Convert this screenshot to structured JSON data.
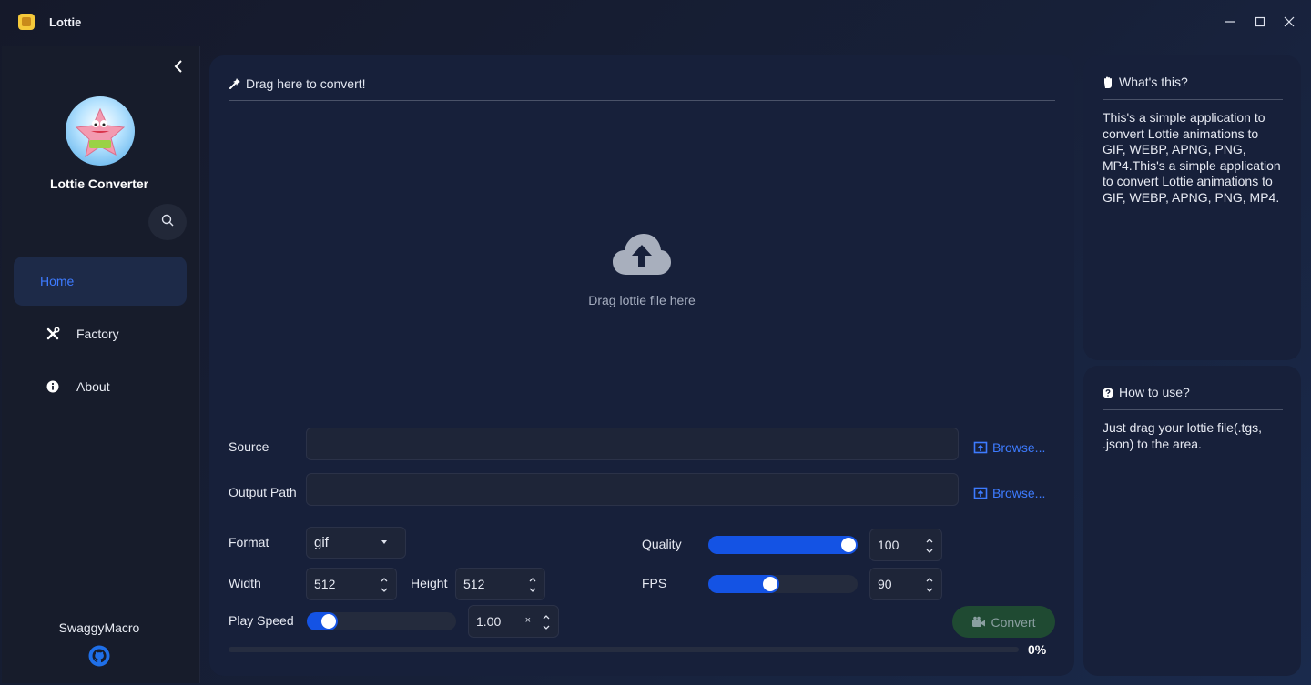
{
  "window": {
    "title": "Lottie",
    "icons": {
      "app": "spongebob-app-icon",
      "minimize": "minimize-icon",
      "maximize": "maximize-icon",
      "close": "close-icon"
    }
  },
  "sidebar": {
    "app_name": "Lottie Converter",
    "author": "SwaggyMacro",
    "items": [
      {
        "label": "Home",
        "icon": "home",
        "active": true
      },
      {
        "label": "Factory",
        "icon": "tools-icon",
        "active": false
      },
      {
        "label": "About",
        "icon": "info-icon",
        "active": false
      }
    ],
    "icons": {
      "collapse": "chevron-left-icon",
      "search": "search-icon",
      "github": "github-icon",
      "avatar": "patrick-star-avatar"
    }
  },
  "main": {
    "drag_header": "Drag here to convert!",
    "drop_text": "Drag lottie file here",
    "source": {
      "label": "Source",
      "value": "",
      "browse": "Browse..."
    },
    "output": {
      "label": "Output Path",
      "value": "",
      "browse": "Browse..."
    },
    "format": {
      "label": "Format",
      "value": "gif"
    },
    "width": {
      "label": "Width",
      "value": "512"
    },
    "height": {
      "label": "Height",
      "value": "512"
    },
    "play_speed": {
      "label": "Play Speed",
      "value": "1.00",
      "suffix": "×",
      "level": 0.1
    },
    "quality": {
      "label": "Quality",
      "value": "100",
      "level": 1.0
    },
    "fps": {
      "label": "FPS",
      "value": "90",
      "level": 0.4
    },
    "convert_label": "Convert",
    "progress": {
      "percent": 0,
      "text": "0%"
    }
  },
  "info": {
    "whats_this": {
      "title": "What's this?",
      "text": "This's a simple application to convert Lottie animations to GIF, WEBP, APNG, PNG, MP4.This's a simple application to convert Lottie animations to GIF, WEBP, APNG, PNG, MP4."
    },
    "how_to_use": {
      "title": "How to use?",
      "text": "Just drag your lottie file(.tgs, .json) to the area."
    }
  },
  "colors": {
    "accent": "#3d7bff",
    "slider_fill": "#1453e4",
    "convert_bg": "#1f4a32"
  }
}
